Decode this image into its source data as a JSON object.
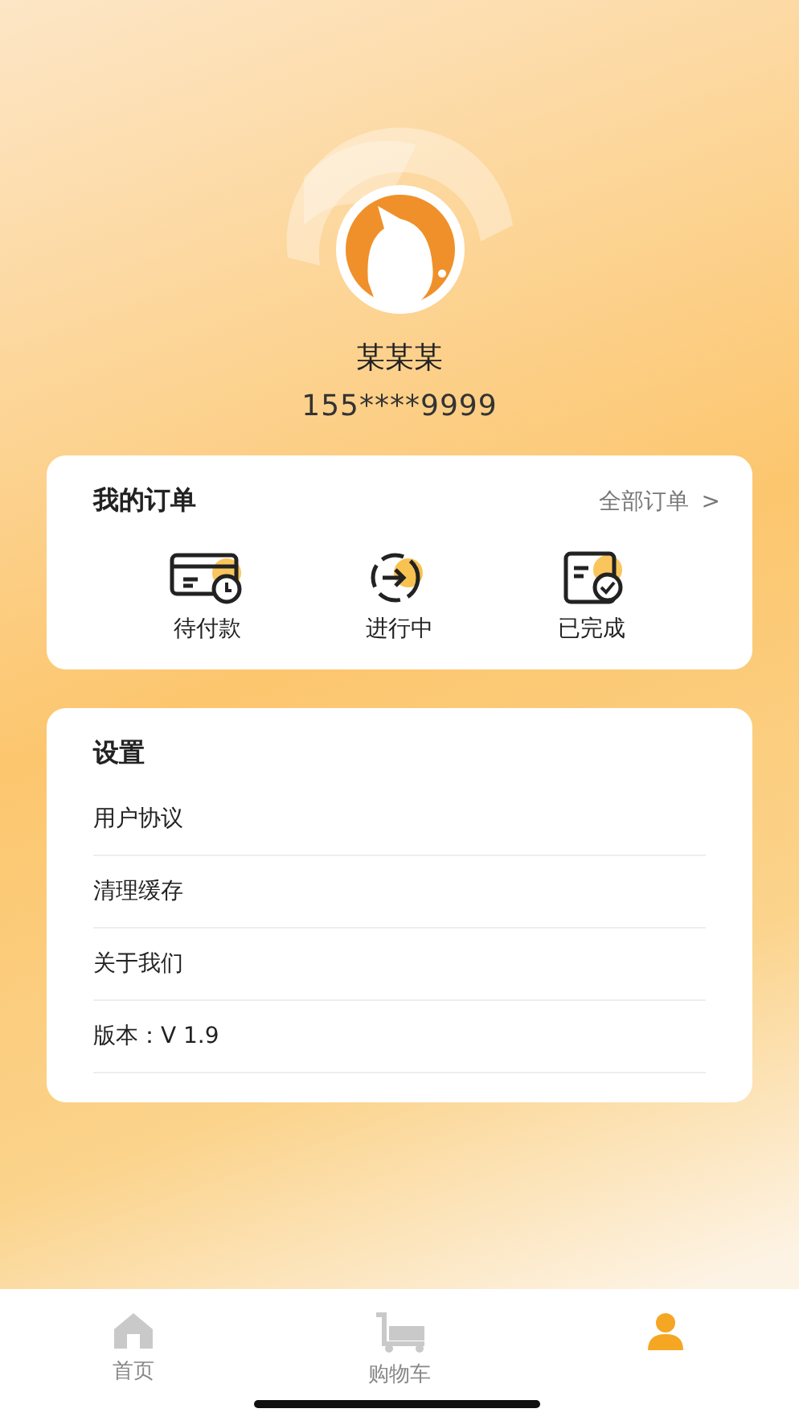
{
  "profile": {
    "name": "某某某",
    "phone": "155****9999"
  },
  "orders": {
    "title": "我的订单",
    "all_link": "全部订单",
    "chevron": ">",
    "items": [
      {
        "kind": "pending",
        "label": "待付款"
      },
      {
        "kind": "progress",
        "label": "进行中"
      },
      {
        "kind": "done",
        "label": "已完成"
      }
    ]
  },
  "settings": {
    "title": "设置",
    "items": [
      "用户协议",
      "清理缓存",
      "关于我们",
      "版本：V 1.9"
    ]
  },
  "tabbar": [
    {
      "kind": "home",
      "label": "首页",
      "selected": false
    },
    {
      "kind": "cart",
      "label": "购物车",
      "selected": false
    },
    {
      "kind": "user",
      "selected": true
    }
  ]
}
